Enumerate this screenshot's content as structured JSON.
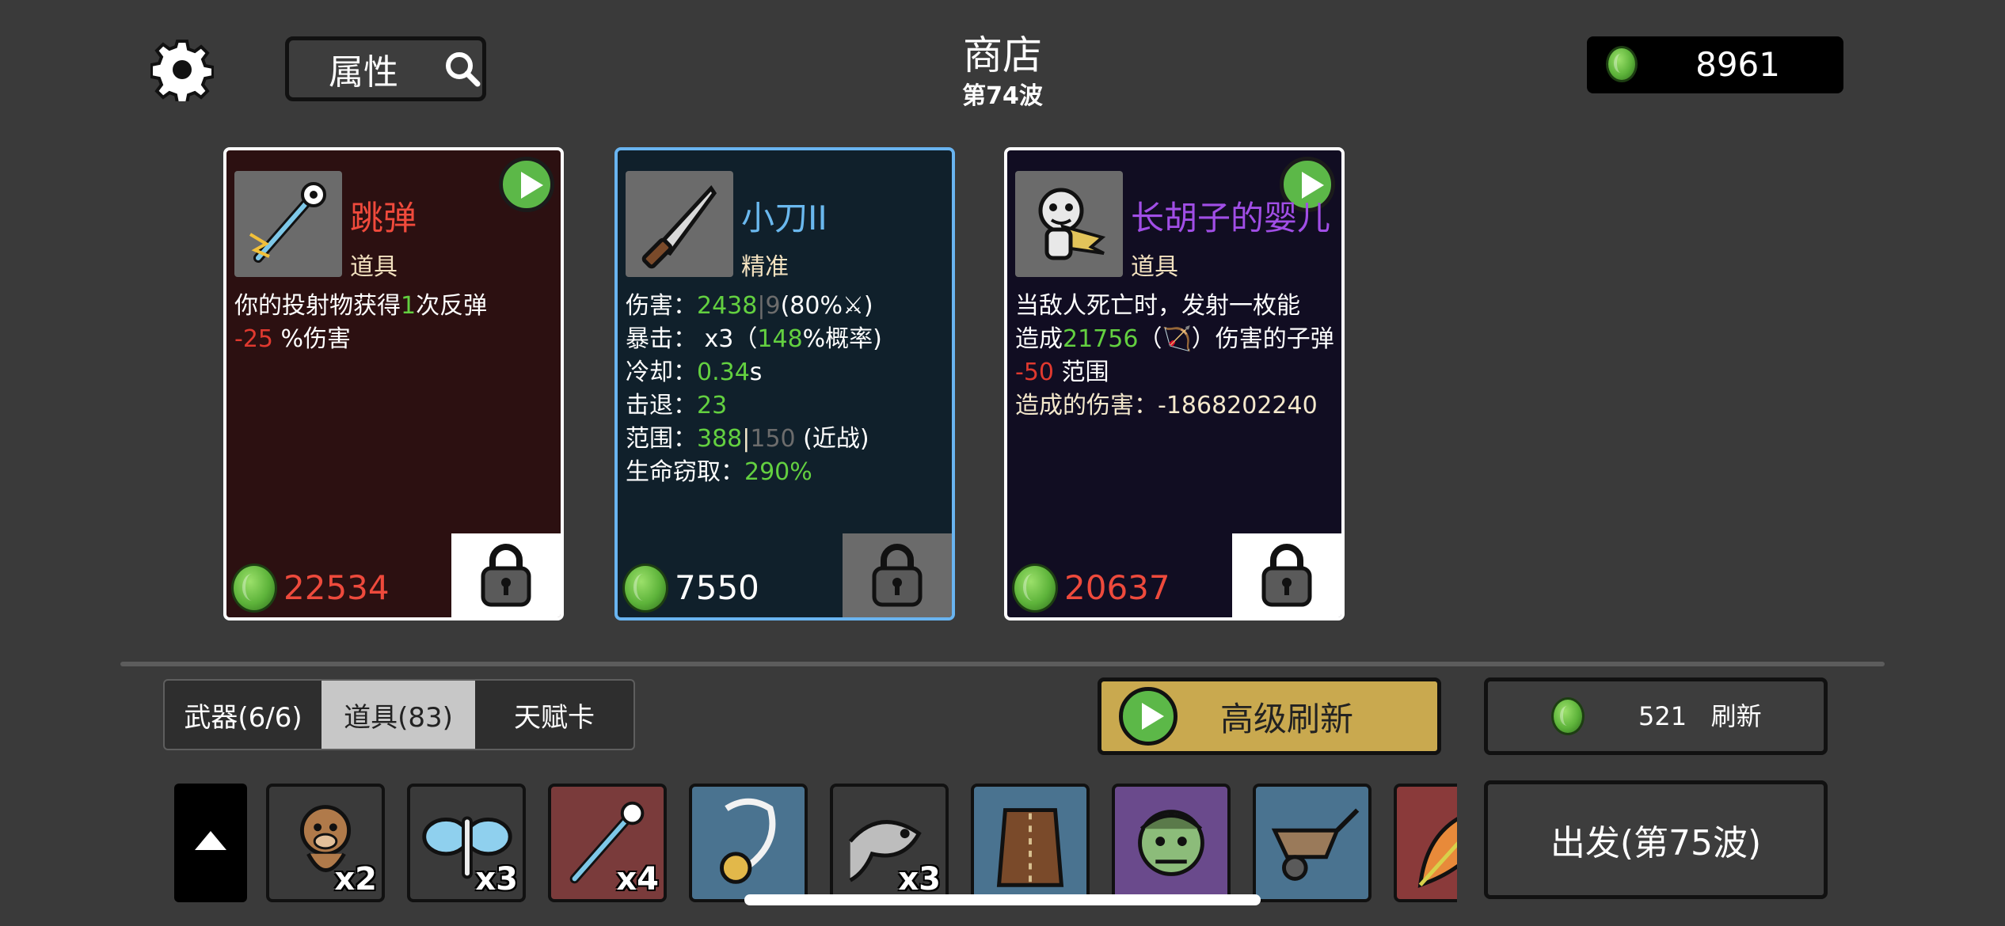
{
  "header": {
    "attr_label": "属性",
    "title": "商店",
    "wave": "第74波",
    "money": "8961"
  },
  "cards": [
    {
      "name": "跳弹",
      "name_color": "#f04a3c",
      "type": "道具",
      "lines": [
        [
          {
            "t": "你的投射物获得"
          },
          {
            "t": "1",
            "c": "g"
          },
          {
            "t": "次反弹"
          }
        ],
        [
          {
            "t": "-25",
            "c": "r"
          },
          {
            "t": " %伤害"
          }
        ]
      ],
      "price": "22534",
      "price_color": "#ee4a3c",
      "icon": "ricochet-wand-icon"
    },
    {
      "name": "小刀II",
      "name_color": "#6ab8ee",
      "type": "精准",
      "lines": [
        [
          {
            "t": "伤害："
          },
          {
            "t": "2438",
            "c": "g"
          },
          {
            "t": "|",
            "c": "dim"
          },
          {
            "t": "9",
            "c": "dim"
          },
          {
            "t": "(80%"
          },
          {
            "t": "⚔"
          },
          {
            "t": ")"
          }
        ],
        [
          {
            "t": "暴击： x3（"
          },
          {
            "t": "148",
            "c": "g"
          },
          {
            "t": "%概率)"
          }
        ],
        [
          {
            "t": "冷却："
          },
          {
            "t": "0.34",
            "c": "g"
          },
          {
            "t": "s"
          }
        ],
        [
          {
            "t": "击退："
          },
          {
            "t": "23",
            "c": "g"
          }
        ],
        [
          {
            "t": "范围："
          },
          {
            "t": "388",
            "c": "g"
          },
          {
            "t": "|",
            "c": "cream"
          },
          {
            "t": "150",
            "c": "dim"
          },
          {
            "t": " (近战)"
          }
        ],
        [
          {
            "t": "生命窃取："
          },
          {
            "t": "290%",
            "c": "g"
          }
        ]
      ],
      "price": "7550",
      "price_color": "#ffffff",
      "icon": "knife-icon"
    },
    {
      "name": "长胡子的婴儿",
      "name_color": "#a14ee6",
      "type": "道具",
      "lines": [
        [
          {
            "t": "当敌人死亡时，发射一枚能"
          }
        ],
        [
          {
            "t": "造成"
          },
          {
            "t": "21756",
            "c": "g"
          },
          {
            "t": "（"
          },
          {
            "t": "🏹"
          },
          {
            "t": "）伤害的子弹"
          }
        ],
        [
          {
            "t": "-50",
            "c": "r"
          },
          {
            "t": " 范围"
          }
        ],
        [
          {
            "t": "造成的伤害：-1868202240",
            "c": "cream"
          }
        ]
      ],
      "price": "20637",
      "price_color": "#ee4a3c",
      "icon": "bearded-baby-icon"
    }
  ],
  "tabs": [
    "武器(6/6)",
    "道具(83)",
    "天赋卡"
  ],
  "active_tab": 1,
  "advanced_refresh_label": "高级刷新",
  "refresh": {
    "cost": "521",
    "label": "刷新"
  },
  "go_label": "出发(第75波)",
  "inventory": [
    {
      "icon": "monkey-icon",
      "count": "x2",
      "bg": "#3a3a3a"
    },
    {
      "icon": "butterfly-icon",
      "count": "x3",
      "bg": "#3a3a3a"
    },
    {
      "icon": "ricochet-wand-icon",
      "count": "x4",
      "bg": "#7a3b3b"
    },
    {
      "icon": "pendant-icon",
      "count": "",
      "bg": "#4a7390"
    },
    {
      "icon": "tadpole-icon",
      "count": "x3",
      "bg": "#3a3a3a"
    },
    {
      "icon": "leather-vest-icon",
      "count": "",
      "bg": "#4a7390"
    },
    {
      "icon": "zombie-head-icon",
      "count": "",
      "bg": "#6a4a8c"
    },
    {
      "icon": "wheelbarrow-icon",
      "count": "",
      "bg": "#4a7390"
    },
    {
      "icon": "tropical-leaf-icon",
      "count": "",
      "bg": "#8a3a3a"
    }
  ],
  "colors": {
    "green": "#63d040",
    "red": "#e0392f",
    "accent_blue": "#69b4f0",
    "gold_button": "#c9a94f"
  }
}
